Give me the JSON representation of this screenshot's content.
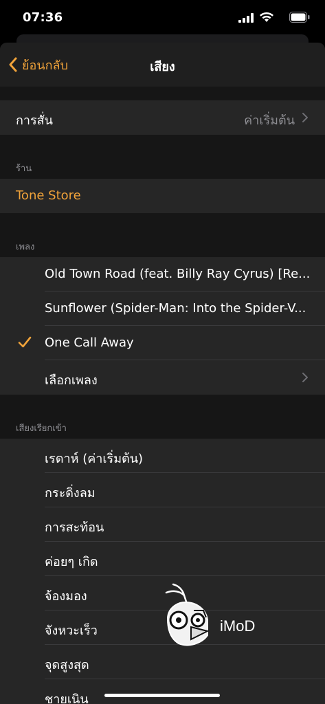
{
  "status_bar": {
    "time": "07:36"
  },
  "nav": {
    "back_label": "ย้อนกลับ",
    "title": "เสียง"
  },
  "vibration": {
    "label": "การสั่น",
    "value": "ค่าเริ่มต้น"
  },
  "store_section": {
    "header": "ร้าน",
    "item": "Tone Store"
  },
  "songs_section": {
    "header": "เพลง",
    "items": [
      {
        "label": "Old Town Road (feat. Billy Ray Cyrus) [Re..."
      },
      {
        "label": "Sunflower (Spider-Man: Into the Spider-V..."
      },
      {
        "label": "One Call Away",
        "selected": true
      },
      {
        "label": "เลือกเพลง"
      }
    ]
  },
  "ringtones_section": {
    "header": "เสียงเรียกเข้า",
    "items": [
      {
        "label": "เรดาห์ (ค่าเริ่มต้น)"
      },
      {
        "label": "กระดิ่งลม"
      },
      {
        "label": "การสะท้อน"
      },
      {
        "label": "ค่อยๆ เกิด"
      },
      {
        "label": "จ้องมอง"
      },
      {
        "label": "จังหวะเร็ว"
      },
      {
        "label": "จุดสูงสุด"
      },
      {
        "label": "ชายเนิน"
      }
    ]
  },
  "watermark": {
    "text": "iMoD"
  },
  "colors": {
    "accent": "#f1a33a",
    "background": "#161616",
    "cell": "#262626",
    "secondary_text": "#8e8e93"
  }
}
